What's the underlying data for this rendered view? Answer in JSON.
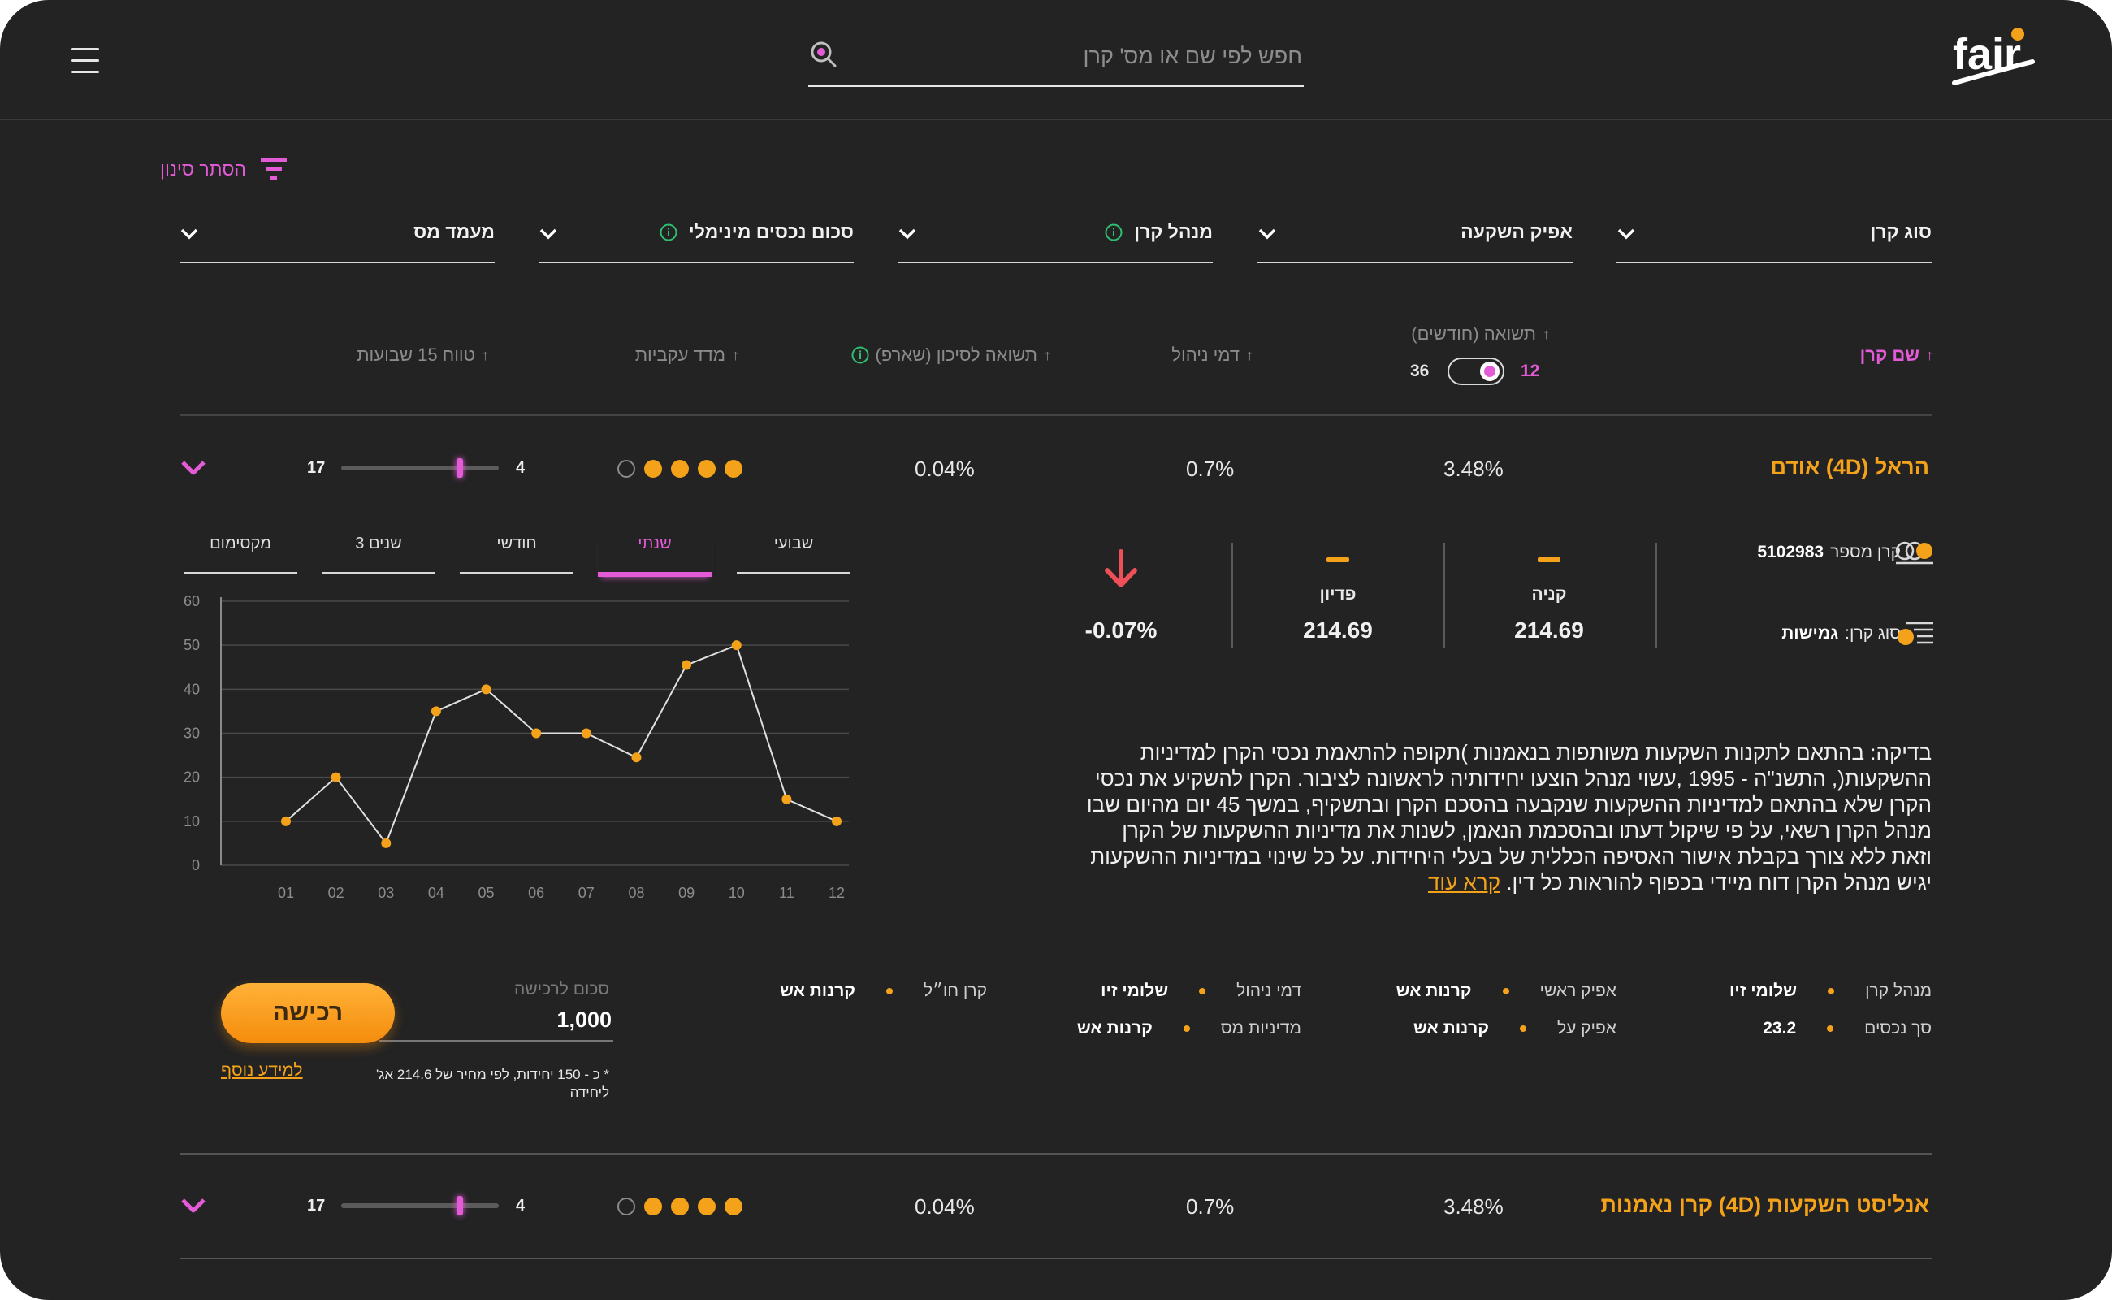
{
  "brand": {
    "logo": "fair",
    "accent": "#e45bd8",
    "orange": "#f5a21b",
    "background": "#232323"
  },
  "search": {
    "placeholder": "חפש לפי שם או מס' קרן"
  },
  "filters": {
    "toggle_label": "הסתר סינון",
    "dropdowns": [
      {
        "label": "סוג קרן"
      },
      {
        "label": "אפיק השקעה"
      },
      {
        "label": "מנהל קרן",
        "info": true
      },
      {
        "label": "סכום נכסים מינימלי",
        "info": true
      },
      {
        "label": "מעמד מס"
      }
    ]
  },
  "columns": {
    "name": "שם קרן",
    "yield": "תשואה (חודשים)",
    "yield_toggle": {
      "left": "36",
      "right": "12"
    },
    "mgmt_fee": "דמי ניהול",
    "sharpe": "תשואה לסיכון (שארפ)",
    "tracking": "מדד עקביות",
    "range": "טווח 15 שבועות"
  },
  "funds": [
    {
      "name": "הראל (4D) אודם",
      "yield": "3.48%",
      "mgmt_fee": "0.7%",
      "sharpe": "0.04%",
      "rating": 4,
      "rating_max": 5,
      "range_low": "4",
      "range_high": "17",
      "range_position": 0.25
    },
    {
      "name": "אנליסט השקעות (4D) קרן נאמנות",
      "yield": "3.48%",
      "mgmt_fee": "0.7%",
      "sharpe": "0.04%",
      "rating": 4,
      "rating_max": 5,
      "range_low": "4",
      "range_high": "17",
      "range_position": 0.25
    }
  ],
  "detail": {
    "tabs": [
      "שבועי",
      "שנתי",
      "חודשי",
      "3 שנים",
      "מקסימום"
    ],
    "active_tab": "שנתי",
    "fund_number_label": "קרן מספר",
    "fund_number": "5102983",
    "fund_type_label": "סוג קרן:",
    "fund_type": "גמישות",
    "buy_label": "קניה",
    "buy_price": "214.69",
    "redeem_label": "פדיון",
    "redeem_price": "214.69",
    "change": "-0.07%",
    "description": "בדיקה: בהתאם לתקנות השקעות משותפות בנאמנות )תקופה להתאמת נכסי הקרן למדיניות ההשקעות(, התשנ\"ה - 1995 ,עשוי מנהל הוצעו יחידותיה לראשונה לציבור. הקרן להשקיע את נכסי הקרן שלא בהתאם למדיניות ההשקעות שנקבעה בהסכם הקרן ובתשקיף, במשך 45 יום מהיום שבו מנהל הקרן רשאי, על פי שיקול דעתו ובהסכמת הנאמן, לשנות את מדיניות ההשקעות של הקרן וזאת ללא צורך בקבלת אישור האסיפה הכללית של בעלי היחידות. על כל שינוי במדיניות ההשקעות יגיש מנהל הקרן דוח מיידי בכפוף להוראות כל דין.",
    "read_more": "קרא עוד",
    "details_rows": [
      [
        {
          "key": "מנהל קרן",
          "value": "שלומי זיו"
        },
        {
          "key": "אפיק ראשי",
          "value": "קרנות אש"
        },
        {
          "key": "דמי ניהול",
          "value": "שלומי זיו"
        },
        {
          "key": "קרן חו״ל",
          "value": "קרנות אש"
        }
      ],
      [
        {
          "key": "סך נכסים",
          "value": "23.2"
        },
        {
          "key": "אפיק על",
          "value": "קרנות אש"
        },
        {
          "key": "מדיניות מס",
          "value": "קרנות אש"
        }
      ]
    ],
    "purchase": {
      "amount_label": "סכום לרכישה",
      "amount": "1,000",
      "button": "רכישה",
      "note": "* כ - 150 יחידות, לפי מחיר של 214.6 אג' ליחידה",
      "more_info": "למידע נוסף"
    }
  },
  "chart_data": {
    "type": "line",
    "x": [
      "01",
      "02",
      "03",
      "04",
      "05",
      "06",
      "07",
      "08",
      "09",
      "10",
      "11",
      "12"
    ],
    "values": [
      10,
      20,
      5,
      35,
      40,
      30,
      30,
      24.5,
      45.5,
      50,
      15,
      10
    ],
    "ylim": [
      0,
      60
    ],
    "yticks": [
      0,
      10,
      20,
      30,
      40,
      50,
      60
    ],
    "grid": true,
    "line_color": "#e0e0e0",
    "point_color": "#f5a21b"
  }
}
